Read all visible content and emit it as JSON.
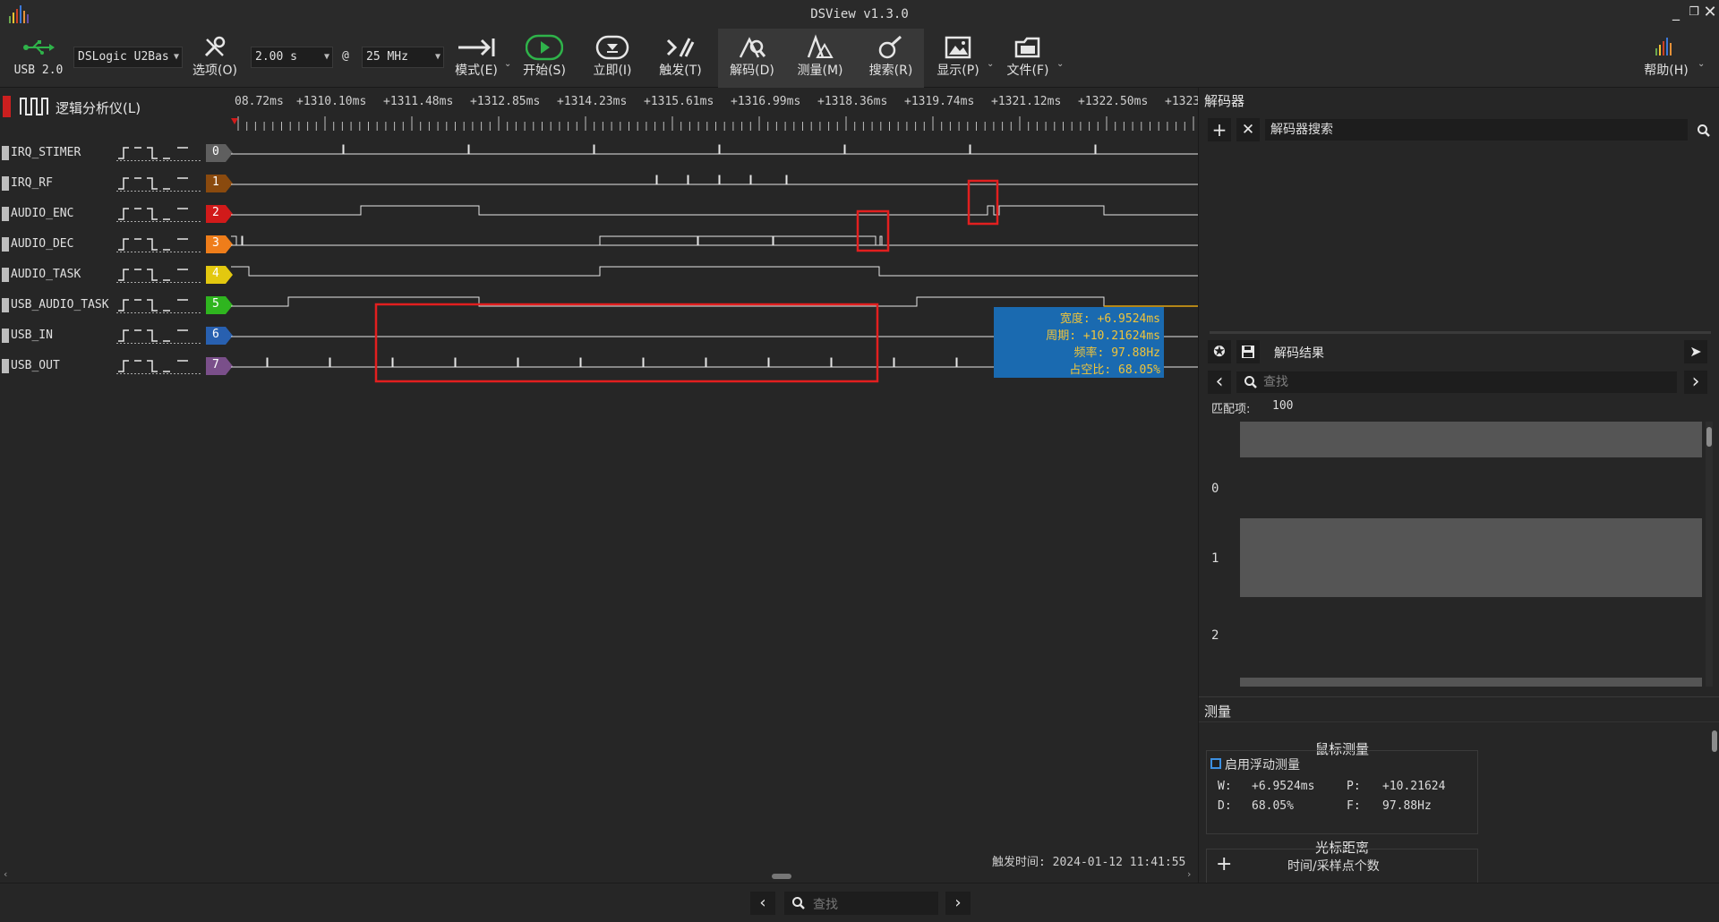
{
  "window": {
    "title": "DSView v1.3.0"
  },
  "toolbar": {
    "usb_label": "USB 2.0",
    "device": "DSLogic U2Bas",
    "options": "选项(O)",
    "duration": "2.00 s",
    "at": "@",
    "samplerate": "25 MHz",
    "mode": "模式(E)",
    "start": "开始(S)",
    "instant": "立即(I)",
    "trigger": "触发(T)",
    "decode": "解码(D)",
    "measure": "测量(M)",
    "search": "搜索(R)",
    "display": "显示(P)",
    "file": "文件(F)",
    "help": "帮助(H)"
  },
  "wave": {
    "tab_label": "逻辑分析仪(L)",
    "ruler": [
      "08.72ms",
      "+1310.10ms",
      "+1311.48ms",
      "+1312.85ms",
      "+1314.23ms",
      "+1315.61ms",
      "+1316.99ms",
      "+1318.36ms",
      "+1319.74ms",
      "+1321.12ms",
      "+1322.50ms",
      "+1323."
    ],
    "channels": [
      {
        "name": "IRQ_STIMER",
        "index": "0",
        "color": "#5f5f5f"
      },
      {
        "name": "IRQ_RF",
        "index": "1",
        "color": "#8a4a0e"
      },
      {
        "name": "AUDIO_ENC",
        "index": "2",
        "color": "#d11a1a"
      },
      {
        "name": "AUDIO_DEC",
        "index": "3",
        "color": "#ef7d1a"
      },
      {
        "name": "AUDIO_TASK",
        "index": "4",
        "color": "#e3c80f"
      },
      {
        "name": "USB_AUDIO_TASK",
        "index": "5",
        "color": "#2fb51f"
      },
      {
        "name": "USB_IN",
        "index": "6",
        "color": "#2860b0"
      },
      {
        "name": "USB_OUT",
        "index": "7",
        "color": "#7a4f8a"
      }
    ],
    "measure_box": {
      "width": "宽度: +6.9524ms",
      "period": "周期: +10.21624ms",
      "freq": "频率: 97.88Hz",
      "duty": "占空比: 68.05%"
    },
    "trigger_time": "触发时间: 2024-01-12 11:41:55"
  },
  "bottom": {
    "search_placeholder": "查找"
  },
  "decoder": {
    "title": "解码器",
    "search_placeholder": "解码器搜索",
    "results_title": "解码结果",
    "find_placeholder": "查找",
    "match_label": "匹配项:",
    "match_count": "100",
    "rows": [
      "0",
      "1",
      "2"
    ]
  },
  "measure": {
    "title": "测量",
    "mouse_title": "鼠标测量",
    "float_checkbox": "启用浮动测量",
    "w_label": "W:",
    "w_value": "+6.9524ms",
    "p_label": "P:",
    "p_value": "+10.21624",
    "d_label": "D:",
    "d_value": "68.05%",
    "f_label": "F:",
    "f_value": "97.88Hz",
    "cursor_title": "光标距离",
    "cursor_sub": "时间/采样点个数"
  }
}
